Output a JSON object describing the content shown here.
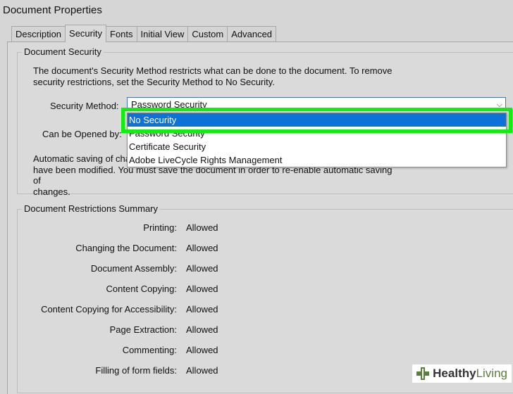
{
  "window": {
    "title": "Document Properties"
  },
  "tabs": [
    {
      "label": "Description"
    },
    {
      "label": "Security"
    },
    {
      "label": "Fonts"
    },
    {
      "label": "Initial View"
    },
    {
      "label": "Custom"
    },
    {
      "label": "Advanced"
    }
  ],
  "security": {
    "group_title": "Document Security",
    "description": "The document's Security Method restricts what can be done to the document. To remove security restrictions, set the Security Method to No Security.",
    "method_label": "Security Method:",
    "method_value": "Password Security",
    "opened_by_label": "Can be Opened by:",
    "autosave_text_line1": "Automatic saving of cha",
    "autosave_text_line2": "have been modified. You must save the document in order to re-enable automatic saving of",
    "autosave_text_line3": "changes.",
    "options": [
      {
        "label": "No Security",
        "selected": true
      },
      {
        "label": "Password Security",
        "selected": false
      },
      {
        "label": "Certificate Security",
        "selected": false
      },
      {
        "label": "Adobe LiveCycle Rights Management",
        "selected": false
      }
    ]
  },
  "restrictions": {
    "group_title": "Document Restrictions Summary",
    "rows": [
      {
        "label": "Printing:",
        "value": "Allowed"
      },
      {
        "label": "Changing the Document:",
        "value": "Allowed"
      },
      {
        "label": "Document Assembly:",
        "value": "Allowed"
      },
      {
        "label": "Content Copying:",
        "value": "Allowed"
      },
      {
        "label": "Content Copying for Accessibility:",
        "value": "Allowed"
      },
      {
        "label": "Page Extraction:",
        "value": "Allowed"
      },
      {
        "label": "Commenting:",
        "value": "Allowed"
      },
      {
        "label": "Filling of form fields:",
        "value": "Allowed"
      }
    ]
  },
  "watermark": {
    "part1": "Healthy",
    "part2": "Living"
  },
  "colors": {
    "selection": "#0b73d8",
    "highlight": "#10ee10",
    "background": "#d6d6d6"
  }
}
